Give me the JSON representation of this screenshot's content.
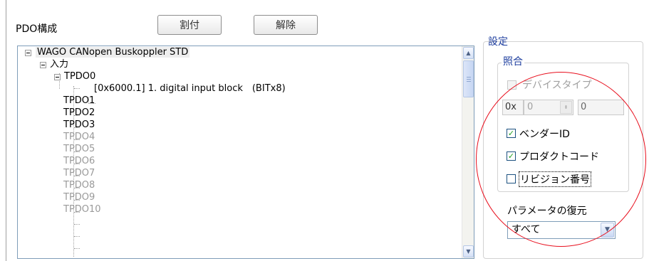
{
  "pdo_config": {
    "title": "PDO構成",
    "assign_button": "割付",
    "release_button": "解除"
  },
  "tree": {
    "root": "WAGO CANopen Buskoppler STD",
    "input": "入力",
    "tpdo0": "TPDO0",
    "tpdo0_child": "[0x6000.1] 1. digital input block　(BITx8)",
    "items": [
      "TPDO1",
      "TPDO2",
      "TPDO3",
      "TPDO4",
      "TPDO5",
      "TPDO6",
      "TPDO7",
      "TPDO8",
      "TPDO9",
      "TPDO10"
    ]
  },
  "settings": {
    "title": "設定",
    "match": {
      "title": "照合",
      "device_type": "デバイスタイプ",
      "hex_prefix": "0x",
      "hex_value": "0",
      "hex_secondary": "0",
      "vendor_id": "ベンダーID",
      "product_code": "プロダクトコード",
      "revision": "リビジョン番号"
    },
    "restore": {
      "label": "パラメータの復元",
      "selected": "すべて"
    }
  },
  "colors": {
    "group_title": "#1f3f9f",
    "check_mark": "#21a121",
    "highlight": "#e8101e",
    "disabled_text": "#a0a0a0"
  }
}
